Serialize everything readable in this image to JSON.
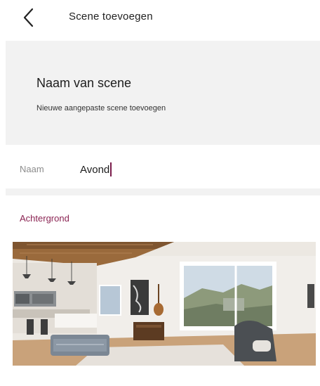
{
  "header": {
    "back_icon": "chevron-left-icon",
    "title": "Scene toevoegen"
  },
  "intro": {
    "heading": "Naam van scene",
    "description": "Nieuwe aangepaste scene toevoegen"
  },
  "name_field": {
    "label": "Naam",
    "value": "Avond"
  },
  "background": {
    "label": "Achtergrond",
    "image_subject": "living-room-photo"
  },
  "colors": {
    "accent": "#8a2352",
    "caret": "#7a1b4a",
    "panel": "#f2f2f2"
  }
}
